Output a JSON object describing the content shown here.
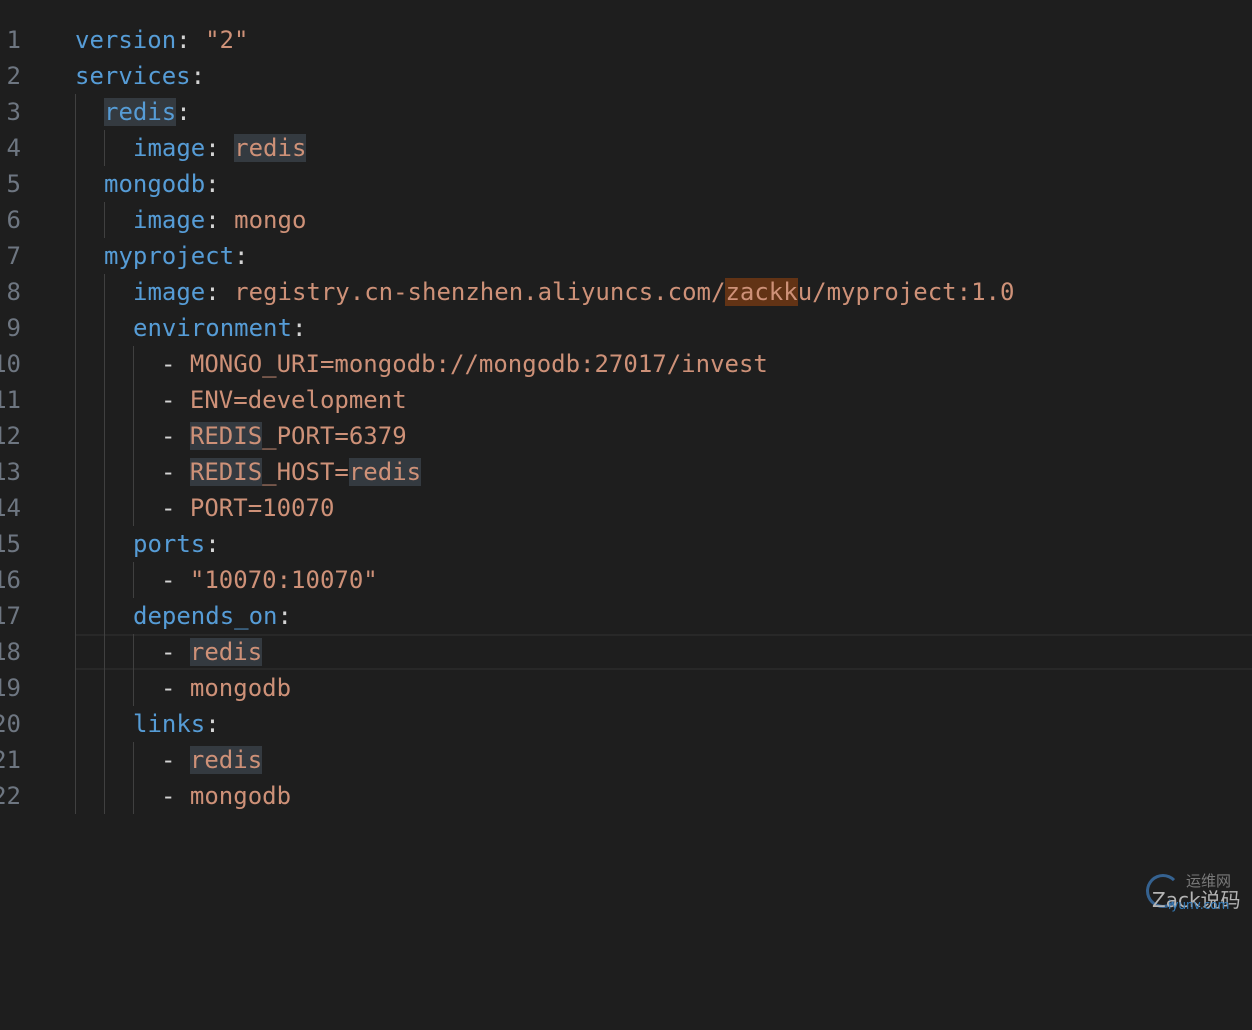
{
  "editor": {
    "line_numbers": [
      "1",
      "2",
      "3",
      "4",
      "5",
      "6",
      "7",
      "8",
      "9",
      "10",
      "11",
      "12",
      "13",
      "14",
      "15",
      "16",
      "17",
      "18",
      "19",
      "20",
      "21",
      "22"
    ],
    "current_line": 18,
    "tokens": {
      "l1_k": "version",
      "l1_p": ": ",
      "l1_s": "\"2\"",
      "l2_k": "services",
      "l2_p": ":",
      "l3_k": "redis",
      "l3_p": ":",
      "l4_k": "image",
      "l4_p": ": ",
      "l4_s": "redis",
      "l5_k": "mongodb",
      "l5_p": ":",
      "l6_k": "image",
      "l6_p": ": ",
      "l6_s": "mongo",
      "l7_k": "myproject",
      "l7_p": ":",
      "l8_k": "image",
      "l8_p": ": ",
      "l8_s1": "registry.cn-shenzhen.aliyuncs.com/",
      "l8_s2": "zackk",
      "l8_s3": "u/myproject:1.0",
      "l9_k": "environment",
      "l9_p": ":",
      "l10_p": "- ",
      "l10_s": "MONGO_URI=mongodb://mongodb:27017/invest",
      "l11_p": "- ",
      "l11_s": "ENV=development",
      "l12_p": "- ",
      "l12_s1": "REDIS",
      "l12_s2": "_PORT=6379",
      "l13_p": "- ",
      "l13_s1": "REDIS",
      "l13_s2": "_HOST=",
      "l13_s3": "redis",
      "l14_p": "- ",
      "l14_s": "PORT=10070",
      "l15_k": "ports",
      "l15_p": ":",
      "l16_p": "- ",
      "l16_s": "\"10070:10070\"",
      "l17_k": "depends_on",
      "l17_p": ":",
      "l18_p": "- ",
      "l18_s": "redis",
      "l19_p": "- ",
      "l19_s": "mongodb",
      "l20_k": "links",
      "l20_p": ":",
      "l21_p": "- ",
      "l21_s": "redis",
      "l22_p": "- ",
      "l22_s": "mongodb"
    }
  },
  "watermark": {
    "top_text": "运维网",
    "main_text": "Zack说码",
    "url_text": "iyunv.com"
  },
  "colors": {
    "background": "#1e1e1e",
    "key": "#569cd6",
    "string": "#ce9178",
    "punctuation": "#d4d4d4",
    "line_number": "#6e7681",
    "word_highlight": "#343a40",
    "find_highlight": "#623315"
  }
}
